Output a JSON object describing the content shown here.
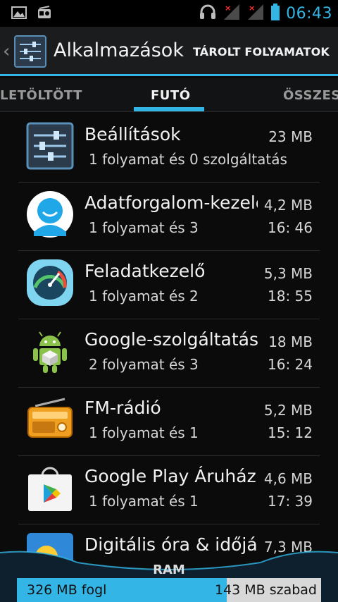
{
  "status_bar": {
    "time": "06:43",
    "icons": [
      "image-icon",
      "radio-icon",
      "headset-icon",
      "signal-no-service-icon",
      "signal-no-service-icon",
      "battery-icon"
    ]
  },
  "action_bar": {
    "title": "Alkalmazások",
    "action": "TÁROLT FOLYAMATOK",
    "icon": "settings-sliders-icon"
  },
  "tabs": {
    "left": "LETÖLTÖTT",
    "center": "FUTÓ",
    "right": "ÖSSZES",
    "selected": "FUTÓ"
  },
  "apps": [
    {
      "name": "Beállítások",
      "size": "23 MB",
      "details": "1 folyamat és 0 szolgáltatás",
      "time": "",
      "icon": "settings-sliders-icon"
    },
    {
      "name": "Adatforgalom-kezelő",
      "size": "4,2 MB",
      "details": "1 folyamat és 3",
      "time": "16: 46",
      "icon": "user-avatar-icon"
    },
    {
      "name": "Feladatkezelő",
      "size": "5,3 MB",
      "details": "1 folyamat és 2",
      "time": "18: 55",
      "icon": "gauge-icon"
    },
    {
      "name": "Google-szolgáltatások",
      "size": "18 MB",
      "details": "2 folyamat és 3",
      "time": "16: 24",
      "icon": "android-robot-icon"
    },
    {
      "name": "FM-rádió",
      "size": "5,2 MB",
      "details": "1 folyamat és 1",
      "time": "15: 12",
      "icon": "radio-icon"
    },
    {
      "name": "Google Play Áruház",
      "size": "4,6 MB",
      "details": "1 folyamat és 1",
      "time": "17: 39",
      "icon": "play-store-bag-icon"
    },
    {
      "name": "Digitális óra & időjárás",
      "size": "7,3 MB",
      "details": "",
      "time": "",
      "icon": "weather-sun-icon"
    }
  ],
  "ram": {
    "label": "RAM",
    "used": "326 MB fogl",
    "free": "143 MB szabad",
    "used_fraction": 0.69
  },
  "colors": {
    "accent": "#33b5e5",
    "background": "#0b0b0c"
  }
}
